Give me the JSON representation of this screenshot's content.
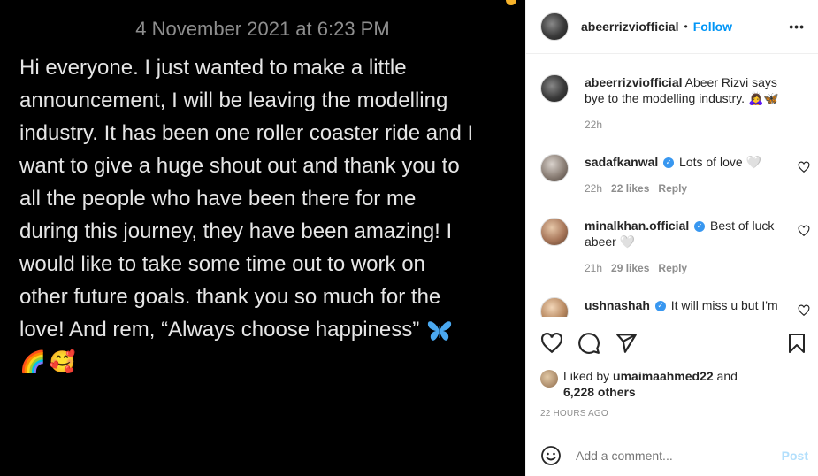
{
  "media": {
    "date_label": "4 November 2021 at 6:23 PM",
    "story_lines": [
      "Hi everyone. I just wanted to make a little",
      "announcement, I will be leaving the modelling",
      "industry. It has been one roller coaster ride and I",
      "want to give a huge shout out and thank you to",
      "all the people who have been there for me",
      "during this journey, they have been amazing! I",
      "would like to take some time out to work on",
      "other future goals. thank you so much for the",
      "love! And rem, “Always choose happiness”"
    ],
    "emojis": [
      "🌈",
      "🥰"
    ],
    "accent_color": "#f7b32b"
  },
  "header": {
    "username": "abeerrizviofficial",
    "separator": "•",
    "follow_label": "Follow",
    "more_label": "•••"
  },
  "caption": {
    "username": "abeerrizviofficial",
    "text": "Abeer Rizvi says bye to the modelling industry. 🙇‍♀️🦋",
    "time": "22h"
  },
  "comments": [
    {
      "username": "sadafkanwal",
      "verified": true,
      "text": "Lots of love 🤍",
      "time": "22h",
      "likes": "22 likes",
      "reply": "Reply"
    },
    {
      "username": "minalkhan.official",
      "verified": true,
      "text": "Best of luck abeer 🤍",
      "time": "21h",
      "likes": "29 likes",
      "reply": "Reply"
    },
    {
      "username": "ushnashah",
      "verified": true,
      "text": "It will miss u but I'm"
    }
  ],
  "likes": {
    "prefix": "Liked by",
    "user": "umaimaahmed22",
    "and": "and",
    "others": "6,228 others"
  },
  "timestamp": "22 HOURS AGO",
  "add_comment": {
    "placeholder": "Add a comment...",
    "post_label": "Post"
  },
  "colors": {
    "link_blue": "#0095f6",
    "verified_blue": "#3897f0",
    "post_disabled": "#b2dffc"
  },
  "icons": [
    "heart-icon",
    "comment-icon",
    "share-icon",
    "bookmark-icon",
    "smile-icon",
    "verified-icon",
    "butterfly-icon"
  ]
}
